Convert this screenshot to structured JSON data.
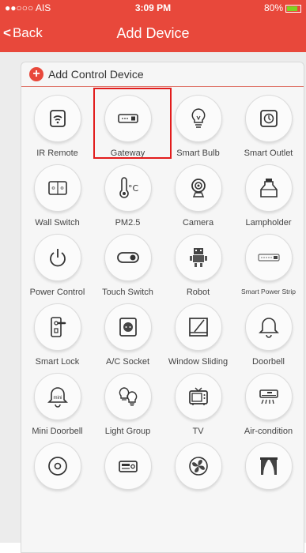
{
  "status_bar": {
    "carrier": "●●○○○ AIS",
    "time": "3:09 PM",
    "battery": "80%"
  },
  "nav": {
    "back_label": "Back",
    "title": "Add Device"
  },
  "section": {
    "title": "Add Control Device"
  },
  "devices": [
    {
      "label": "IR Remote",
      "icon": "wifi-icon"
    },
    {
      "label": "Gateway",
      "icon": "gateway-icon",
      "highlighted": true
    },
    {
      "label": "Smart Bulb",
      "icon": "bulb-icon"
    },
    {
      "label": "Smart Outlet",
      "icon": "outlet-icon"
    },
    {
      "label": "Wall Switch",
      "icon": "wall-switch-icon"
    },
    {
      "label": "PM2.5",
      "icon": "thermometer-icon"
    },
    {
      "label": "Camera",
      "icon": "camera-icon"
    },
    {
      "label": "Lampholder",
      "icon": "lampholder-icon"
    },
    {
      "label": "Power Control",
      "icon": "power-icon"
    },
    {
      "label": "Touch Switch",
      "icon": "toggle-icon"
    },
    {
      "label": "Robot",
      "icon": "robot-icon"
    },
    {
      "label": "Smart Power Strip",
      "icon": "power-strip-icon"
    },
    {
      "label": "Smart Lock",
      "icon": "lock-icon"
    },
    {
      "label": "A/C Socket",
      "icon": "socket-icon"
    },
    {
      "label": "Window Sliding",
      "icon": "window-icon"
    },
    {
      "label": "Doorbell",
      "icon": "bell-icon"
    },
    {
      "label": "Mini Doorbell",
      "icon": "mini-bell-icon",
      "icon_text": "mini"
    },
    {
      "label": "Light Group",
      "icon": "bulbs-icon"
    },
    {
      "label": "TV",
      "icon": "tv-icon"
    },
    {
      "label": "Air-condition",
      "icon": "aircon-icon"
    },
    {
      "label": "",
      "icon": "speaker-icon"
    },
    {
      "label": "",
      "icon": "radio-icon"
    },
    {
      "label": "",
      "icon": "fan-icon"
    },
    {
      "label": "",
      "icon": "curtain-icon"
    }
  ],
  "colors": {
    "accent": "#e8483b",
    "highlight_border": "#e21c1c"
  }
}
